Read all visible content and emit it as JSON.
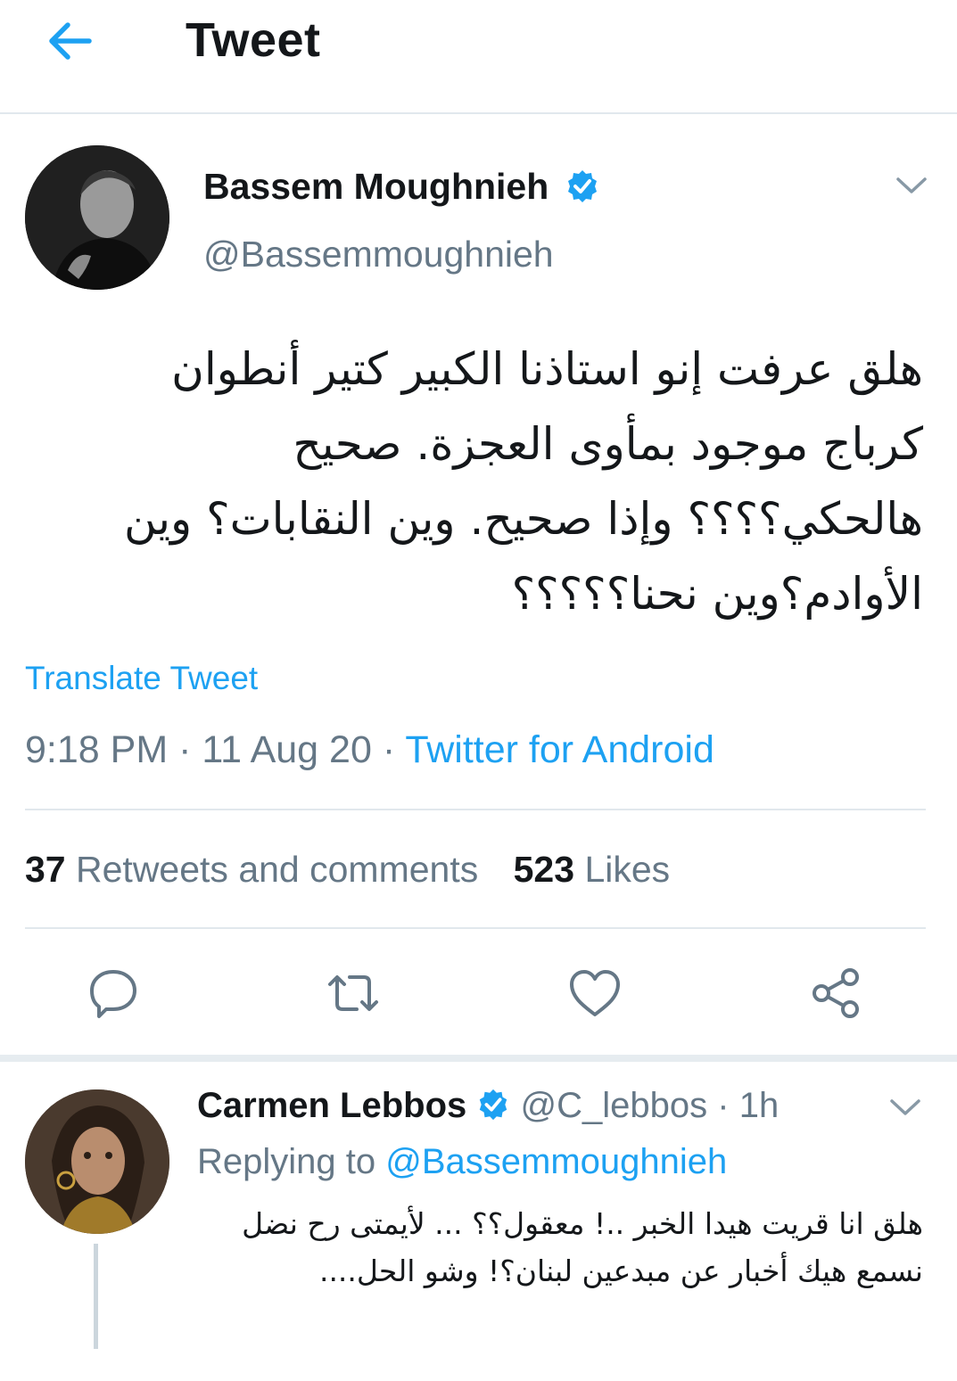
{
  "header": {
    "title": "Tweet",
    "back_icon": "arrow-left-icon"
  },
  "tweet": {
    "author_name": "Bassem Moughnieh",
    "handle": "@Bassemmoughnieh",
    "verified": true,
    "text": "هلق عرفت إنو استاذنا الكبير كتير أنطوان كرباج موجود بمأوى العجزة. صحيح هالحكي؟؟؟؟ وإذا صحيح. وين النقابات؟ وين الأوادم؟وين نحنا؟؟؟؟؟",
    "translate": "Translate Tweet",
    "time": "9:18 PM",
    "date": "11 Aug 20",
    "separator": "·",
    "source": "Twitter for Android",
    "retweets_count": "37",
    "retweets_label": "Retweets and comments",
    "likes_count": "523",
    "likes_label": "Likes"
  },
  "actions": [
    "reply-icon",
    "retweet-icon",
    "heart-icon",
    "share-icon"
  ],
  "reply": {
    "author_name": "Carmen Lebbos",
    "handle": "@C_lebbos",
    "time": "1h",
    "separator": "·",
    "verified": true,
    "replying_prefix": "Replying to",
    "replying_handle": "@Bassemmoughnieh",
    "text": "هلق انا قريت هيدا الخبر ..! معقول؟؟ ... لأيمتى رح نضل نسمع هيك أخبار عن مبدعين لبنان؟! وشو الحل...."
  },
  "colors": {
    "accent": "#1da1f2",
    "muted": "#657786",
    "divider": "#e1e8ed"
  }
}
